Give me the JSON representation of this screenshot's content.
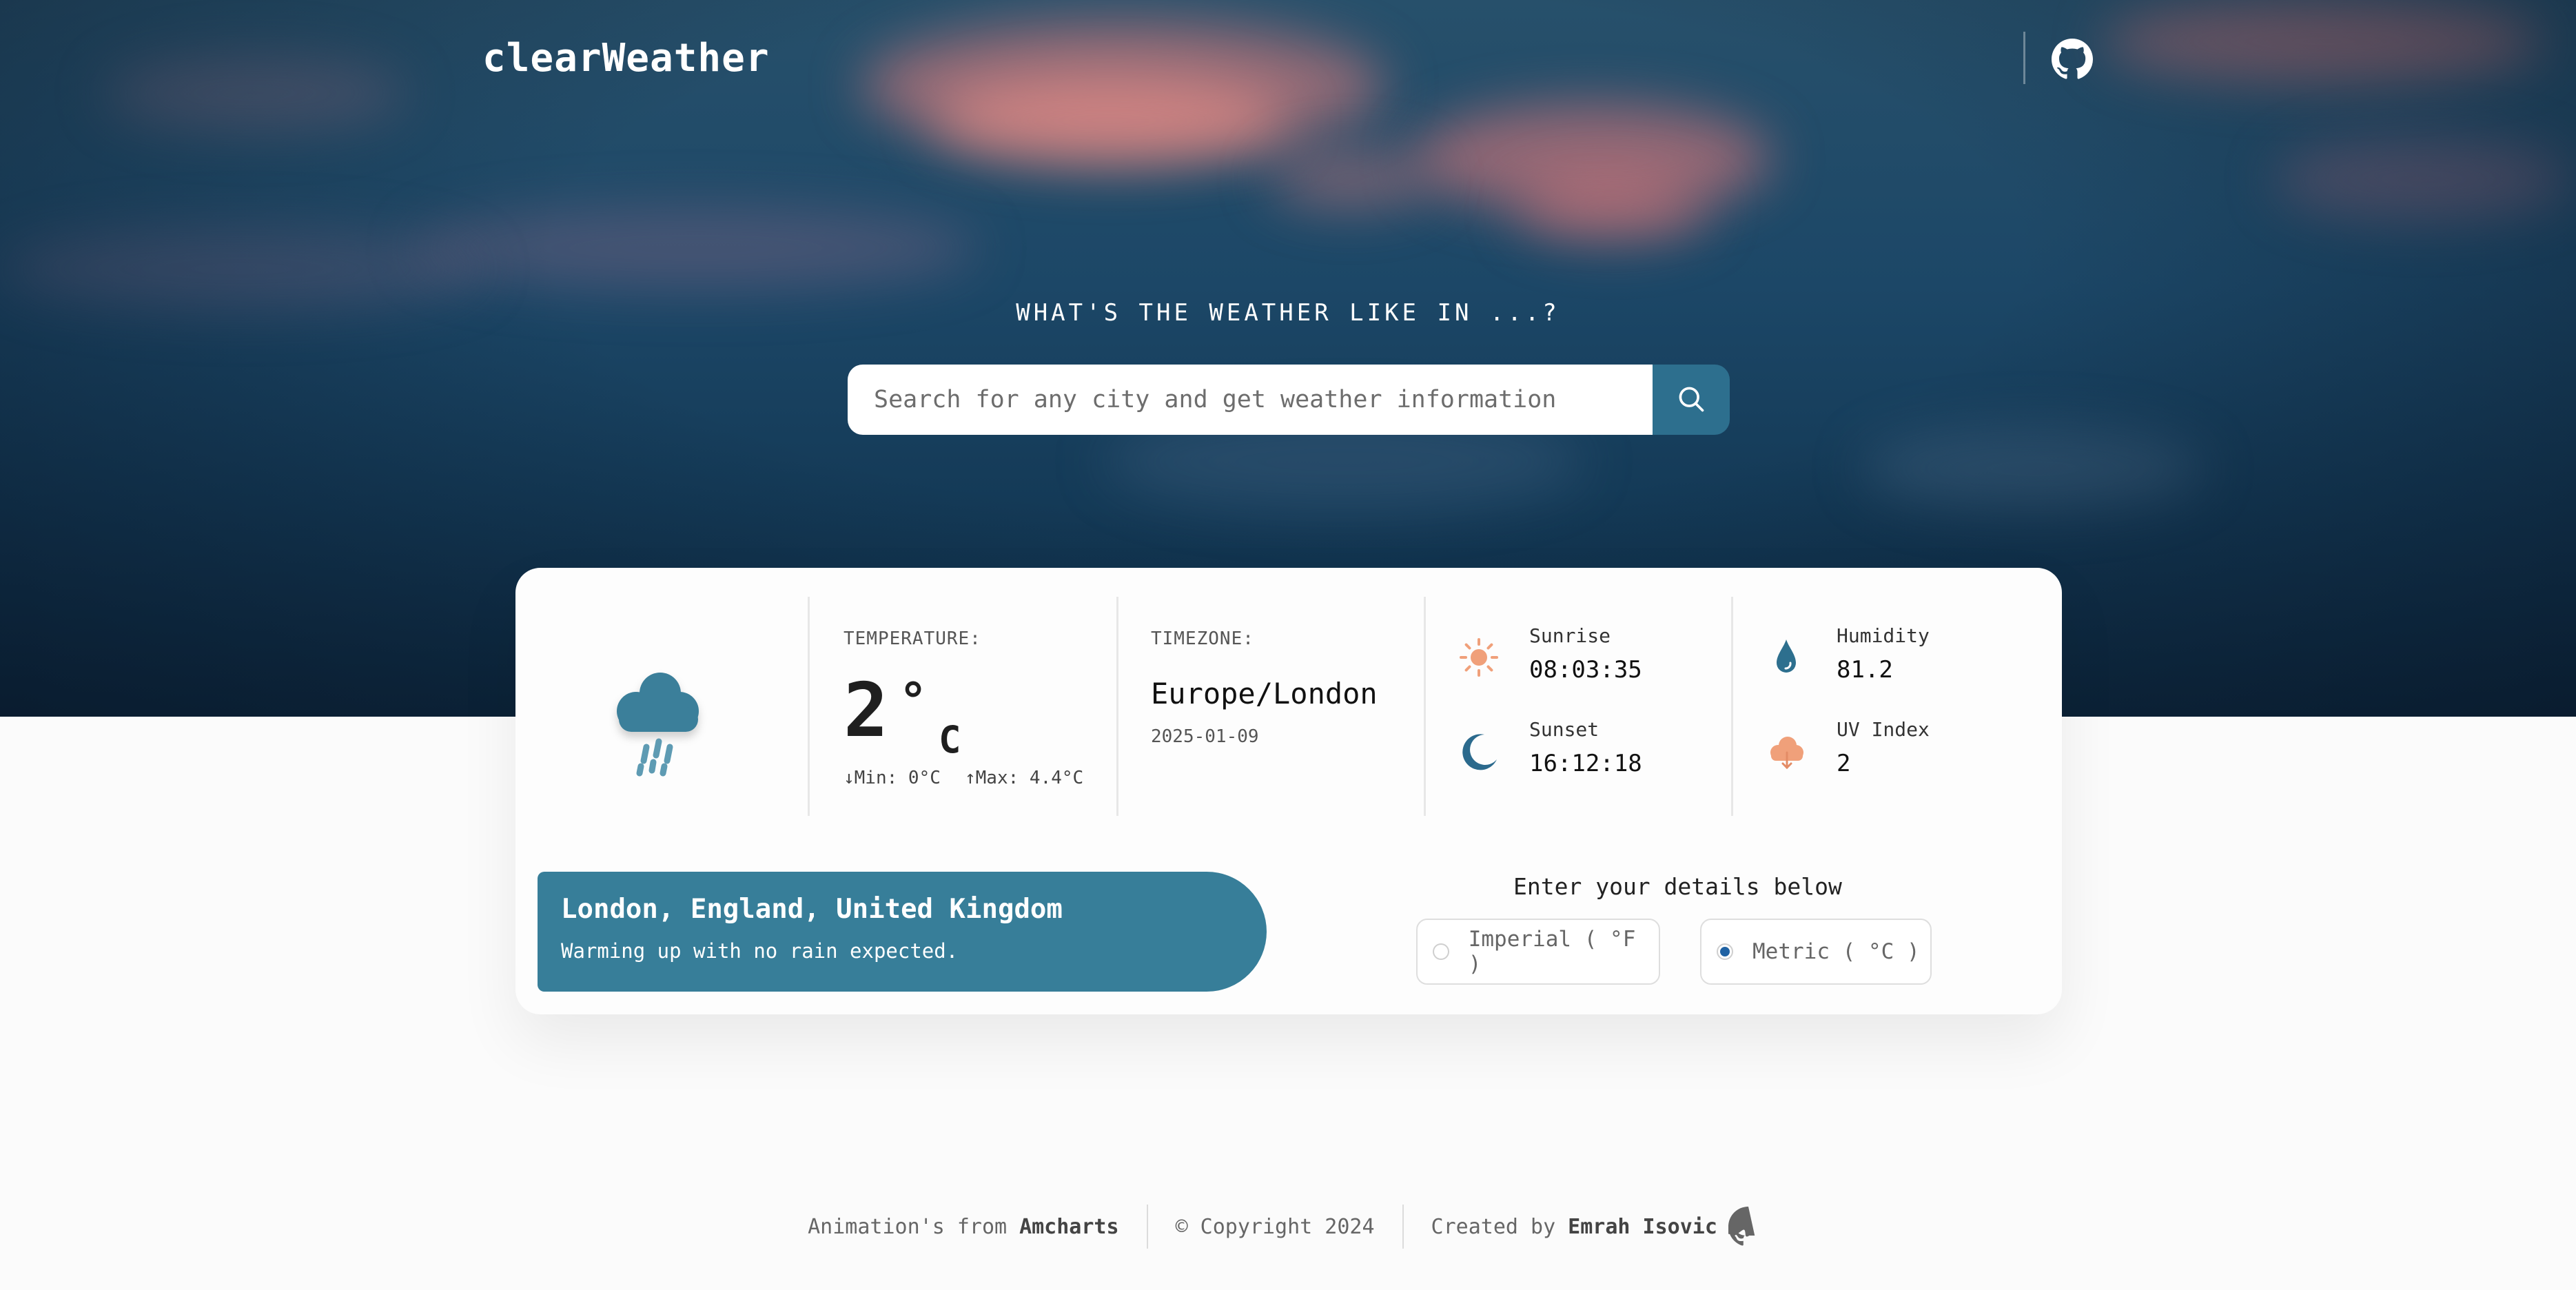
{
  "app": {
    "brand": "clearWeather"
  },
  "hero": {
    "question": "WHAT'S THE WEATHER LIKE IN ...?",
    "search": {
      "placeholder": "Search for any city and get weather information",
      "value": ""
    }
  },
  "weather": {
    "icon": "rain-cloud-icon",
    "temperature_label": "TEMPERATURE:",
    "temperature": "2",
    "degree_symbol": "°",
    "unit": "C",
    "min": "↓Min: 0°C",
    "max": "↑Max: 4.4°C",
    "timezone_label": "TIMEZONE:",
    "timezone": "Europe/London",
    "date": "2025-01-09",
    "sunrise_label": "Sunrise",
    "sunrise": "08:03:35",
    "sunset_label": "Sunset",
    "sunset": "16:12:18",
    "humidity_label": "Humidity",
    "humidity": "81.2",
    "uv_label": "UV Index",
    "uv": "2"
  },
  "location": {
    "name": "London, England, United Kingdom",
    "description": "Warming up with no rain expected."
  },
  "units": {
    "title": "Enter your details below",
    "options": [
      {
        "label": "Imperial ( °F )",
        "selected": false
      },
      {
        "label": "Metric ( °C )",
        "selected": true
      }
    ]
  },
  "footer": {
    "animations_text": "Animation's from",
    "animations_link": "Amcharts",
    "copyright": "© Copyright 2024",
    "created_text": "Created by",
    "author": "Emrah Isovic"
  },
  "colors": {
    "accent": "#377e99",
    "search_button": "#2d6f8e",
    "sun_orange": "#f0a07a",
    "moon_blue": "#2b6a8d"
  }
}
